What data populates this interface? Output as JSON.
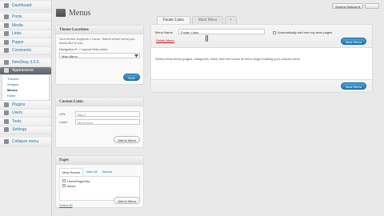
{
  "sidebar": {
    "items": [
      {
        "label": "Dashboard",
        "icon": "dashboard-icon"
      },
      {
        "label": "Posts",
        "icon": "posts-icon"
      },
      {
        "label": "Media",
        "icon": "media-icon"
      },
      {
        "label": "Links",
        "icon": "links-icon"
      },
      {
        "label": "Pages",
        "icon": "pages-icon"
      },
      {
        "label": "Comments",
        "icon": "comments-icon"
      },
      {
        "label": "NewSkay 3.9.5",
        "icon": "theme-icon"
      },
      {
        "label": "Appearance",
        "icon": "appearance-icon"
      },
      {
        "label": "Plugins",
        "icon": "plugins-icon"
      },
      {
        "label": "Users",
        "icon": "users-icon"
      },
      {
        "label": "Tools",
        "icon": "tools-icon"
      },
      {
        "label": "Settings",
        "icon": "settings-icon"
      },
      {
        "label": "Collapse menu",
        "icon": "collapse-icon"
      }
    ],
    "submenu": [
      {
        "label": "Themes"
      },
      {
        "label": "Widgets"
      },
      {
        "label": "Menus"
      },
      {
        "label": "Editor"
      }
    ]
  },
  "topbar": {
    "user_label": "Screen Options ▾"
  },
  "page": {
    "title": "Menus"
  },
  "theme_locations": {
    "title": "Theme Locations",
    "description": "Your theme supports 1 menu. Select which menu you would like to use.",
    "location_label": "Navigation 0: = Layout Only menu",
    "select_value": "Main Menu",
    "save_label": "Save"
  },
  "custom_links": {
    "title": "Custom Links",
    "url_label": "URL",
    "url_value": "http://",
    "label_label": "Label",
    "label_placeholder": "Menu Item",
    "add_label": "Add to Menu"
  },
  "pages": {
    "title": "Pages",
    "tabs": [
      "Most Recent",
      "View All",
      "Search"
    ],
    "items": [
      "HomePageOnly",
      "About"
    ],
    "select_all": "Select All",
    "add_label": "Add to Menu"
  },
  "menu_tabs": [
    "Footer Links",
    "Main Menu",
    "+"
  ],
  "editor": {
    "name_label": "Menu Name",
    "name_value": "Footer Links",
    "auto_add_label": "Automatically add new top-level pages",
    "delete_label": "Delete Menu",
    "save_label": "Save Menu",
    "message": "Select menu items (pages, categories, links) from the boxes at left to begin building your custom menu.",
    "save_label_bottom": "Save Menu"
  }
}
